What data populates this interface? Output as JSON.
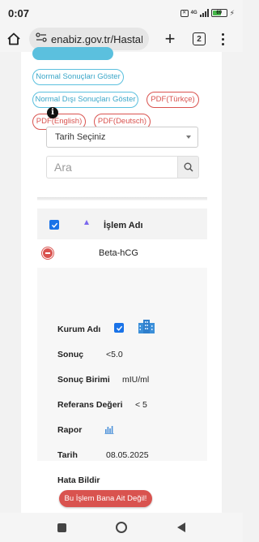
{
  "status_bar": {
    "time": "0:07",
    "network": "4G",
    "battery_percent": "69"
  },
  "browser": {
    "url": "enabiz.gov.tr/HastaBil",
    "tab_count": "2"
  },
  "filters": {
    "normal_label": "Normal Sonuçları Göster",
    "abnormal_label": "Normal Dışı Sonuçları Göster",
    "pdf_turkish": "PDF(Türkçe)",
    "pdf_english": "PDF(English)",
    "pdf_deutsch": "PDF(Deutsch)"
  },
  "date_select": {
    "selected": "Tarih Seçiniz"
  },
  "search": {
    "placeholder": "Ara"
  },
  "table": {
    "column_header": "İşlem Adı",
    "row": {
      "name": "Beta-hCG",
      "details": {
        "institution_label": "Kurum Adı",
        "result_label": "Sonuç",
        "result_value": "<5.0",
        "unit_label": "Sonuç Birimi",
        "unit_value": "mIU/ml",
        "reference_label": "Referans Değeri",
        "reference_value": "< 5",
        "report_label": "Rapor",
        "date_label": "Tarih",
        "date_value": "08.05.2025",
        "report_error_label": "Hata Bildir",
        "report_error_button": "Bu İşlem Bana Ait Değil!"
      }
    }
  },
  "colors": {
    "info_blue": "#5bc0de",
    "danger_red": "#d9534f",
    "checkbox_blue": "#1a73e8"
  },
  "icons": [
    "home-icon",
    "site-settings-icon",
    "plus-icon",
    "tabs-icon",
    "menu-icon",
    "info-icon",
    "search-icon",
    "checkbox-icon",
    "sort-asc-icon",
    "collapse-icon",
    "hospital-building-icon",
    "bar-chart-icon"
  ]
}
